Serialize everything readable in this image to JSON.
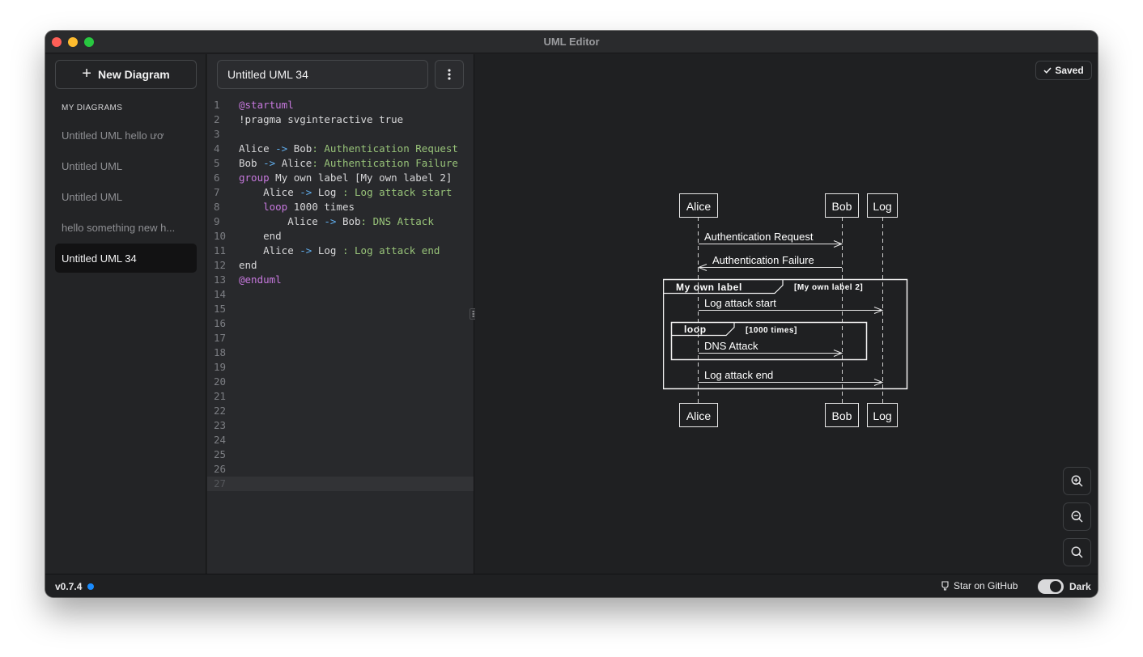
{
  "window": {
    "title": "UML Editor"
  },
  "sidebar": {
    "new_button_label": "New Diagram",
    "heading": "MY DIAGRAMS",
    "items": [
      {
        "label": "Untitled UML hello ươ",
        "active": false
      },
      {
        "label": "Untitled UML",
        "active": false
      },
      {
        "label": "Untitled UML",
        "active": false
      },
      {
        "label": "hello something new h...",
        "active": false
      },
      {
        "label": "Untitled UML 34",
        "active": true
      }
    ]
  },
  "editor": {
    "document_title": "Untitled UML 34",
    "current_line": 27,
    "lines": [
      {
        "n": "1",
        "text": "@startuml"
      },
      {
        "n": "2",
        "text": "!pragma svginteractive true"
      },
      {
        "n": "3",
        "text": ""
      },
      {
        "n": "4",
        "text": "Alice -> Bob: Authentication Request"
      },
      {
        "n": "5",
        "text": "Bob -> Alice: Authentication Failure"
      },
      {
        "n": "6",
        "text": "group My own label [My own label 2]"
      },
      {
        "n": "7",
        "text": "    Alice -> Log : Log attack start"
      },
      {
        "n": "8",
        "text": "    loop 1000 times"
      },
      {
        "n": "9",
        "text": "        Alice -> Bob: DNS Attack"
      },
      {
        "n": "10",
        "text": "    end"
      },
      {
        "n": "11",
        "text": "    Alice -> Log : Log attack end"
      },
      {
        "n": "12",
        "text": "end"
      },
      {
        "n": "13",
        "text": "@enduml"
      },
      {
        "n": "14",
        "text": ""
      },
      {
        "n": "15",
        "text": ""
      },
      {
        "n": "16",
        "text": ""
      },
      {
        "n": "17",
        "text": ""
      },
      {
        "n": "18",
        "text": ""
      },
      {
        "n": "19",
        "text": ""
      },
      {
        "n": "20",
        "text": ""
      },
      {
        "n": "21",
        "text": ""
      },
      {
        "n": "22",
        "text": ""
      },
      {
        "n": "23",
        "text": ""
      },
      {
        "n": "24",
        "text": ""
      },
      {
        "n": "25",
        "text": ""
      },
      {
        "n": "26",
        "text": ""
      },
      {
        "n": "27",
        "text": ""
      }
    ]
  },
  "preview": {
    "saved_label": "Saved",
    "diagram": {
      "participants": [
        "Alice",
        "Bob",
        "Log"
      ],
      "messages": [
        "Authentication Request",
        "Authentication Failure",
        "Log attack start",
        "DNS Attack",
        "Log attack end"
      ],
      "group_label": "My own label",
      "group_condition": "[My own label 2]",
      "loop_label": "loop",
      "loop_condition": "[1000 times]"
    }
  },
  "footer": {
    "version": "v0.7.4",
    "github_label": "Star on GitHub",
    "theme_label": "Dark",
    "theme_on": true
  },
  "colors": {
    "keyword": "#c678dd",
    "arrow": "#61afef",
    "string": "#98c379",
    "status_dot": "#1a8cff"
  }
}
